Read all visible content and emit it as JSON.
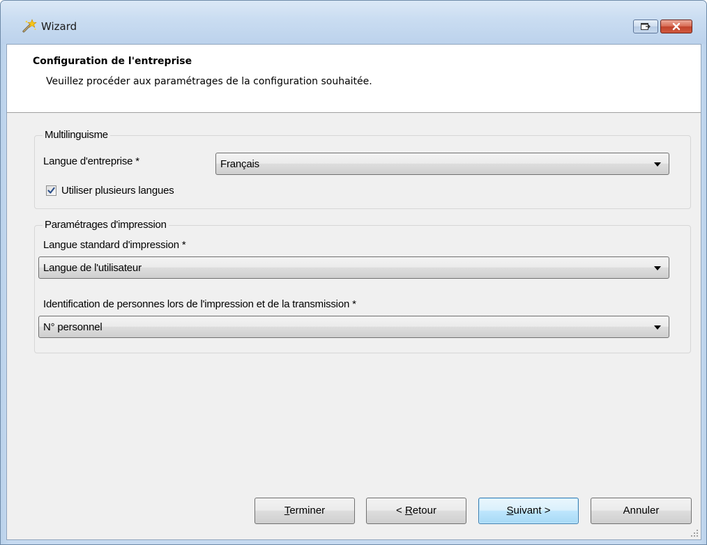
{
  "window": {
    "title": "Wizard",
    "icon": "wizard-wand-icon",
    "controls": {
      "restore": "restore-icon",
      "close": "close-icon"
    }
  },
  "header": {
    "title": "Configuration de l'entreprise",
    "subtitle": "Veuillez procéder aux paramétrages de la configuration souhaitée."
  },
  "multilinguisme": {
    "legend": "Multilinguisme",
    "company_language": {
      "label": "Langue d'entreprise *",
      "value": "Français"
    },
    "multi_language": {
      "label": "Utiliser plusieurs langues",
      "checked": true
    }
  },
  "print_settings": {
    "legend": "Paramétrages d'impression",
    "standard_language": {
      "label": "Langue standard d'impression *",
      "value": "Langue de l'utilisateur"
    },
    "person_identification": {
      "label": "Identification de personnes lors de l'impression et de la transmission *",
      "value": "N° personnel"
    }
  },
  "buttons": {
    "finish": {
      "accel": "T",
      "rest": "erminer"
    },
    "back": {
      "prefix": "< ",
      "accel": "R",
      "rest": "etour"
    },
    "next": {
      "accel": "S",
      "rest": "uivant >"
    },
    "cancel": {
      "label": "Annuler"
    }
  },
  "colors": {
    "title_bar": "#c9dcf1",
    "frame": "#c6daf0",
    "panel": "#f0f0f0",
    "close_button": "#c1432b",
    "default_button_border": "#3c7fb1"
  }
}
